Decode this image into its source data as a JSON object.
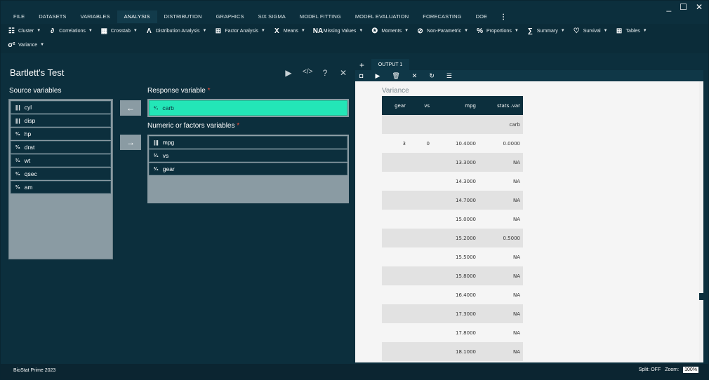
{
  "window": {
    "minimize": "_",
    "maximize": "☐",
    "close": "✕"
  },
  "menu": {
    "items": [
      "FILE",
      "DATASETS",
      "VARIABLES",
      "ANALYSIS",
      "DISTRIBUTION",
      "GRAPHICS",
      "SIX SIGMA",
      "MODEL FITTING",
      "MODEL EVALUATION",
      "FORECASTING",
      "DOE"
    ],
    "active": "ANALYSIS",
    "more": "⋮"
  },
  "toolbar": {
    "row1": [
      {
        "icon": "☷",
        "label": "Cluster"
      },
      {
        "icon": "∂",
        "label": "Correlations"
      },
      {
        "icon": "▦",
        "label": "Crosstab"
      },
      {
        "icon": "Λ",
        "label": "Distribution Analysis"
      },
      {
        "icon": "⊞",
        "label": "Factor Analysis"
      },
      {
        "icon": "X",
        "label": "Means"
      },
      {
        "icon": "NA",
        "label": "Missing Values"
      },
      {
        "icon": "✪",
        "label": "Moments"
      },
      {
        "icon": "⊘",
        "label": "Non-Parametric"
      },
      {
        "icon": "%",
        "label": "Proportions"
      },
      {
        "icon": "∑",
        "label": "Summary"
      },
      {
        "icon": "♡",
        "label": "Survival"
      },
      {
        "icon": "⊞",
        "label": "Tables"
      }
    ],
    "row2": [
      {
        "icon": "σ²",
        "label": "Variance"
      }
    ]
  },
  "dialog": {
    "title": "Bartlett's Test",
    "source_label": "Source variables",
    "source_items": [
      {
        "icon": "|||",
        "name": "cyl"
      },
      {
        "icon": "|||",
        "name": "disp"
      },
      {
        "icon": "²⁄₃",
        "name": "hp"
      },
      {
        "icon": "²⁄₃",
        "name": "drat"
      },
      {
        "icon": "²⁄₃",
        "name": "wt"
      },
      {
        "icon": "²⁄₃",
        "name": "qsec"
      },
      {
        "icon": "²⁄₃",
        "name": "am"
      }
    ],
    "response_label": "Response variable",
    "response_item": {
      "icon": "²⁄₃",
      "name": "carb"
    },
    "factors_label": "Numeric or factors variables",
    "factor_items": [
      {
        "icon": "|||",
        "name": "mpg"
      },
      {
        "icon": "²⁄₃",
        "name": "vs"
      },
      {
        "icon": "²⁄₃",
        "name": "gear"
      }
    ],
    "required_mark": "*",
    "move_left": "←",
    "move_right": "→"
  },
  "output": {
    "add": "+",
    "tab": "OUTPUT 1",
    "heading": "Variance",
    "columns": [
      "gear",
      "vs",
      "mpg",
      "stats..var"
    ],
    "rows": [
      [
        "",
        "",
        "",
        "carb"
      ],
      [
        "3",
        "0",
        "10.4000",
        "0.0000"
      ],
      [
        "",
        "",
        "13.3000",
        "NA"
      ],
      [
        "",
        "",
        "14.3000",
        "NA"
      ],
      [
        "",
        "",
        "14.7000",
        "NA"
      ],
      [
        "",
        "",
        "15.0000",
        "NA"
      ],
      [
        "",
        "",
        "15.2000",
        "0.5000"
      ],
      [
        "",
        "",
        "15.5000",
        "NA"
      ],
      [
        "",
        "",
        "15.8000",
        "NA"
      ],
      [
        "",
        "",
        "16.4000",
        "NA"
      ],
      [
        "",
        "",
        "17.3000",
        "NA"
      ],
      [
        "",
        "",
        "17.8000",
        "NA"
      ],
      [
        "",
        "",
        "18.1000",
        "NA"
      ]
    ]
  },
  "status": {
    "app": "BioStat Prime 2023",
    "split": "Split: OFF",
    "zoom_label": "Zoom:",
    "zoom": "100%"
  }
}
